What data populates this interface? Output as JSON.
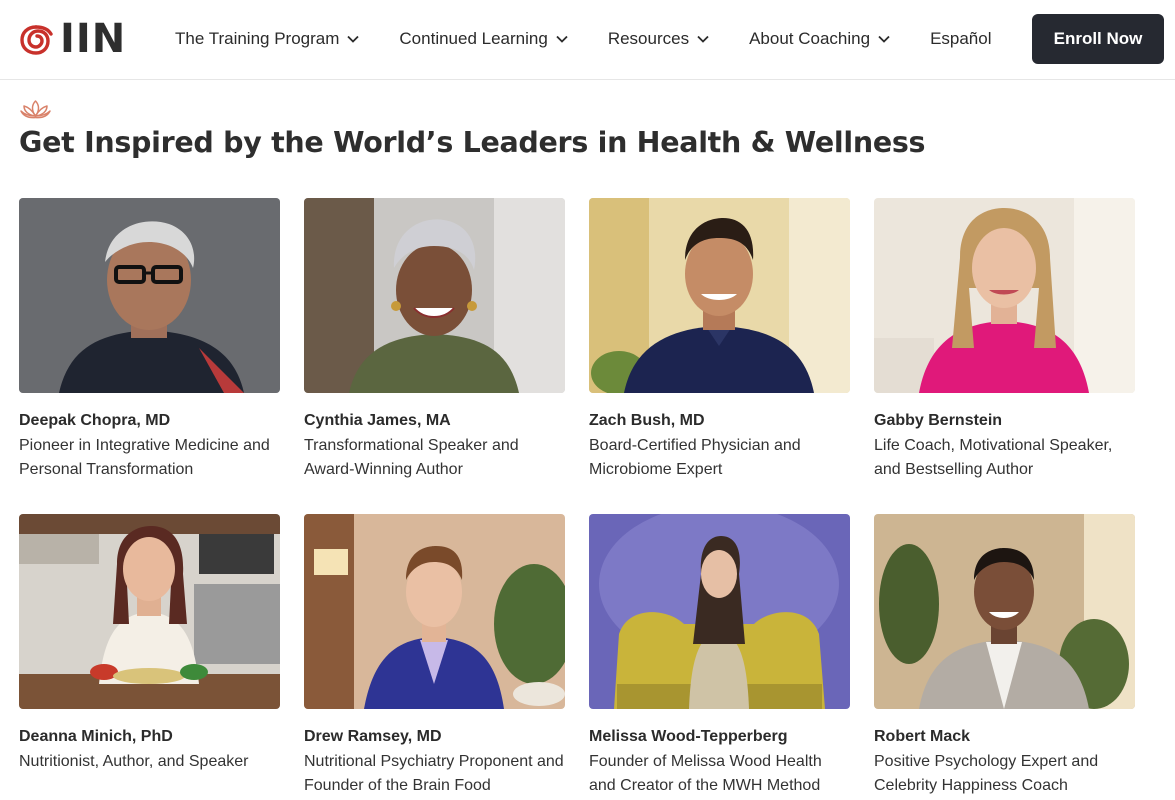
{
  "header": {
    "logo_text": "IIN",
    "nav": [
      {
        "label": "The Training Program",
        "has_dropdown": true
      },
      {
        "label": "Continued Learning",
        "has_dropdown": true
      },
      {
        "label": "Resources",
        "has_dropdown": true
      },
      {
        "label": "About Coaching",
        "has_dropdown": true
      },
      {
        "label": "Español",
        "has_dropdown": false
      }
    ],
    "enroll_label": "Enroll Now"
  },
  "section": {
    "icon": "lotus-icon",
    "heading": "Get Inspired by the World’s Leaders in Health & Wellness"
  },
  "speakers": [
    {
      "name": "Deepak Chopra, MD",
      "title": "Pioneer in Integrative Medicine and Personal Transformation"
    },
    {
      "name": "Cynthia James, MA",
      "title": "Transformational Speaker and Award-Winning Author"
    },
    {
      "name": "Zach Bush, MD",
      "title": "Board-Certified Physician and Microbiome Expert"
    },
    {
      "name": "Gabby Bernstein",
      "title": "Life Coach, Motivational Speaker, and Bestselling Author"
    },
    {
      "name": "Deanna Minich, PhD",
      "title": "Nutritionist, Author, and Speaker"
    },
    {
      "name": "Drew Ramsey, MD",
      "title": "Nutritional Psychiatry Proponent and Founder of the Brain Food"
    },
    {
      "name": "Melissa Wood-Tepperberg",
      "title": "Founder of Melissa Wood Health and Creator of the MWH Method"
    },
    {
      "name": "Robert Mack",
      "title": "Positive Psychology Expert and Celebrity Happiness Coach"
    }
  ],
  "colors": {
    "brand_red": "#c8312b",
    "button_dark": "#262931",
    "lotus": "#d9826a"
  }
}
